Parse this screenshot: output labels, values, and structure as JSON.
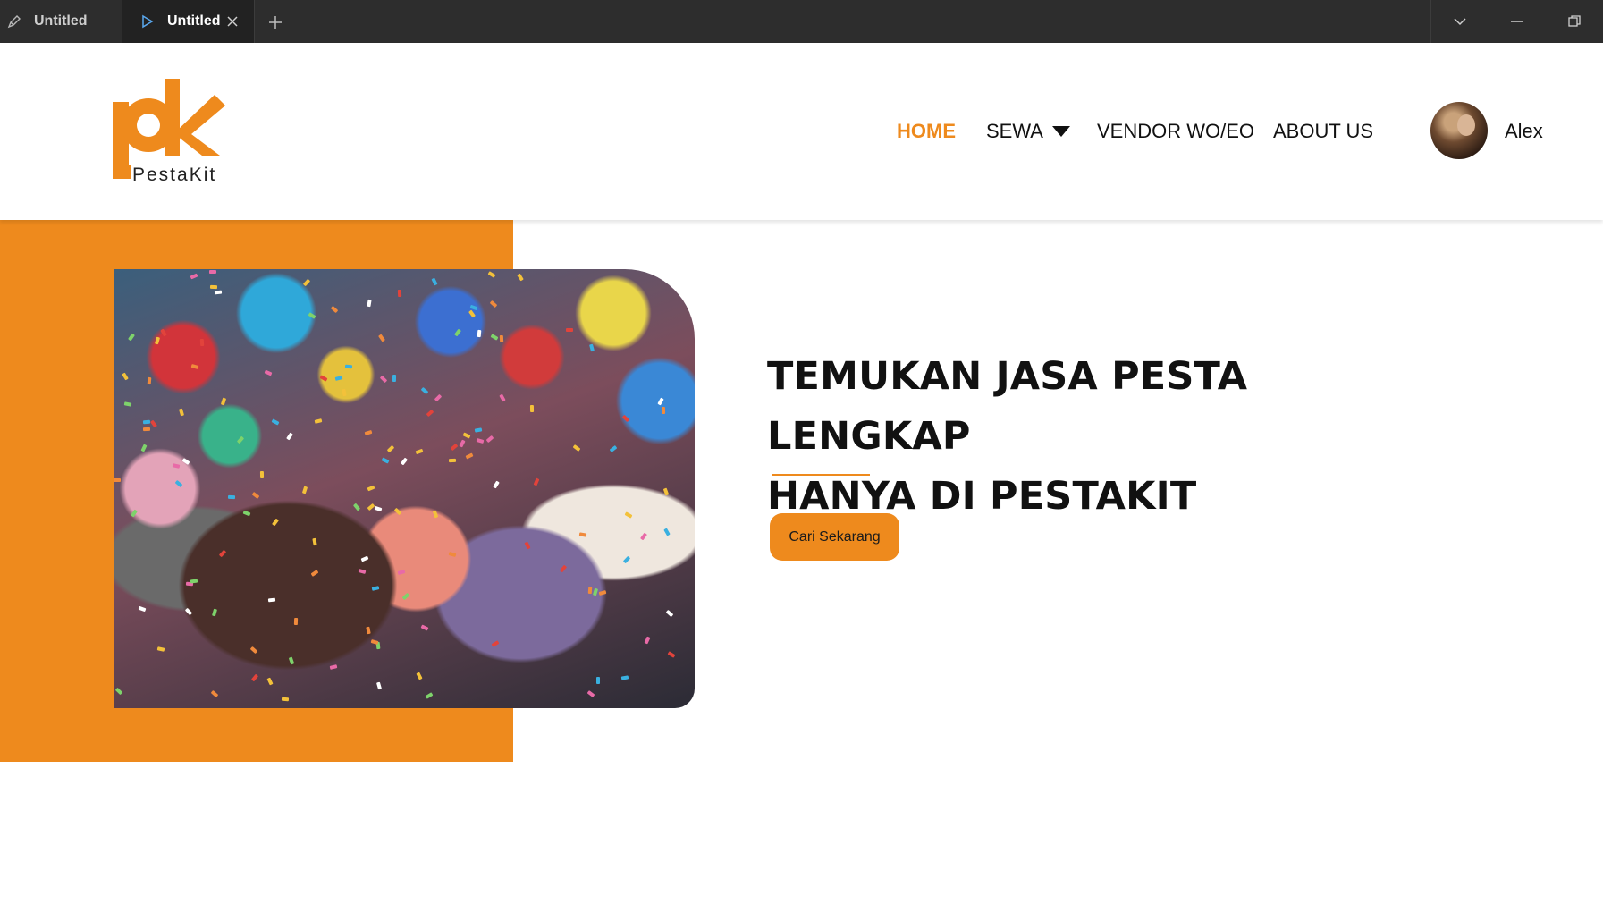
{
  "tabs": [
    {
      "label": "Untitled",
      "icon": "pen-icon"
    },
    {
      "label": "Untitled",
      "icon": "play-icon"
    }
  ],
  "brand": {
    "name": "PestaKit",
    "accent": "#ee8a1d"
  },
  "nav": {
    "home": "HOME",
    "sewa": "SEWA",
    "vendor": "VENDOR WO/EO",
    "about": "ABOUT US",
    "active": "HOME"
  },
  "user": {
    "name": "Alex"
  },
  "hero": {
    "headline_line1": "TEMUKAN JASA PESTA LENGKAP",
    "headline_line2": "HANYA DI PESTAKIT",
    "cta": "Cari Sekarang"
  }
}
